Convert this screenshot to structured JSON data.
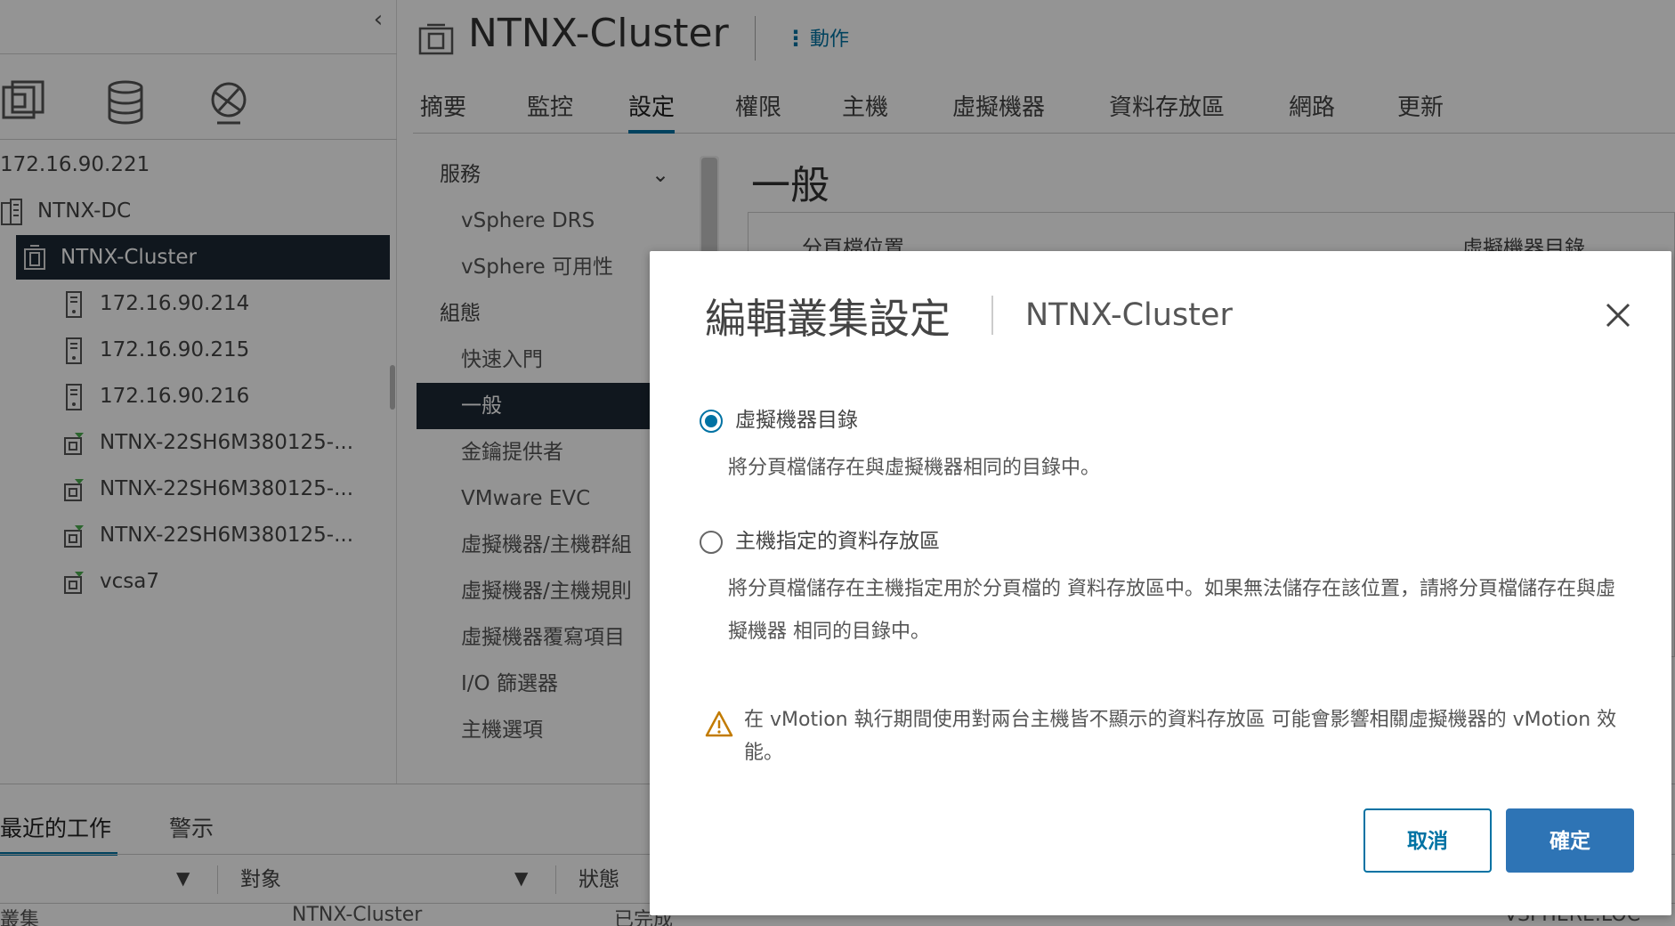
{
  "nav": {
    "tree": [
      {
        "label": "172.16.90.221",
        "icon": "vcenter-icon",
        "indent": 0
      },
      {
        "label": "NTNX-DC",
        "icon": "datacenter-icon",
        "indent": 1
      },
      {
        "label": "NTNX-Cluster",
        "icon": "cluster-icon",
        "indent": 2,
        "selected": true
      },
      {
        "label": "172.16.90.214",
        "icon": "host-icon",
        "indent": 3
      },
      {
        "label": "172.16.90.215",
        "icon": "host-icon",
        "indent": 3
      },
      {
        "label": "172.16.90.216",
        "icon": "host-icon",
        "indent": 3
      },
      {
        "label": "NTNX-22SH6M380125-...",
        "icon": "vm-icon",
        "indent": 3
      },
      {
        "label": "NTNX-22SH6M380125-...",
        "icon": "vm-icon",
        "indent": 3
      },
      {
        "label": "NTNX-22SH6M380125-...",
        "icon": "vm-icon",
        "indent": 3
      },
      {
        "label": "vcsa7",
        "icon": "vm-icon",
        "indent": 3
      }
    ]
  },
  "header": {
    "title": "NTNX-Cluster",
    "actions_label": "動作",
    "tabs": [
      "摘要",
      "監控",
      "設定",
      "權限",
      "主機",
      "虛擬機器",
      "資料存放區",
      "網路",
      "更新"
    ],
    "active_tab": "設定"
  },
  "settings_nav": {
    "group_services": "服務",
    "drs": "vSphere DRS",
    "ha": "vSphere 可用性",
    "group_config": "組態",
    "quickstart": "快速入門",
    "general": "一般",
    "key_provider": "金鑰提供者",
    "evc": "VMware EVC",
    "vm_host_groups": "虛擬機器/主機群組",
    "vm_host_rules": "虛擬機器/主機規則",
    "vm_overrides": "虛擬機器覆寫項目",
    "io_filters": "I/O 篩選器",
    "host_options": "主機選項"
  },
  "content": {
    "heading": "一般",
    "swap_label": "分頁檔位置",
    "swap_value": "虛擬機器目錄"
  },
  "bottom": {
    "tab_recent": "最近的工作",
    "tab_alarms": "警示",
    "col_object": "對象",
    "col_status": "狀態",
    "row_task": "叢集",
    "row_object": "NTNX-Cluster",
    "row_status": "已完成",
    "row_server": "VSPHERE.LOC"
  },
  "modal": {
    "title": "編輯叢集設定",
    "subtitle": "NTNX-Cluster",
    "option1_label": "虛擬機器目錄",
    "option1_desc": "將分頁檔儲存在與虛擬機器相同的目錄中。",
    "option2_label": "主機指定的資料存放區",
    "option2_desc": "將分頁檔儲存在主機指定用於分頁檔的 資料存放區中。如果無法儲存在該位置，請將分頁檔儲存在與虛擬機器 相同的目錄中。",
    "warning": "在 vMotion 執行期間使用對兩台主機皆不顯示的資料存放區 可能會影響相關虛擬機器的 vMotion 效能。",
    "cancel_label": "取消",
    "ok_label": "確定",
    "selected_option": "option1"
  },
  "colors": {
    "accent": "#0072a3",
    "primary_button": "#2e74b5",
    "selected_row": "#1c2834",
    "warning": "#c27b00"
  }
}
